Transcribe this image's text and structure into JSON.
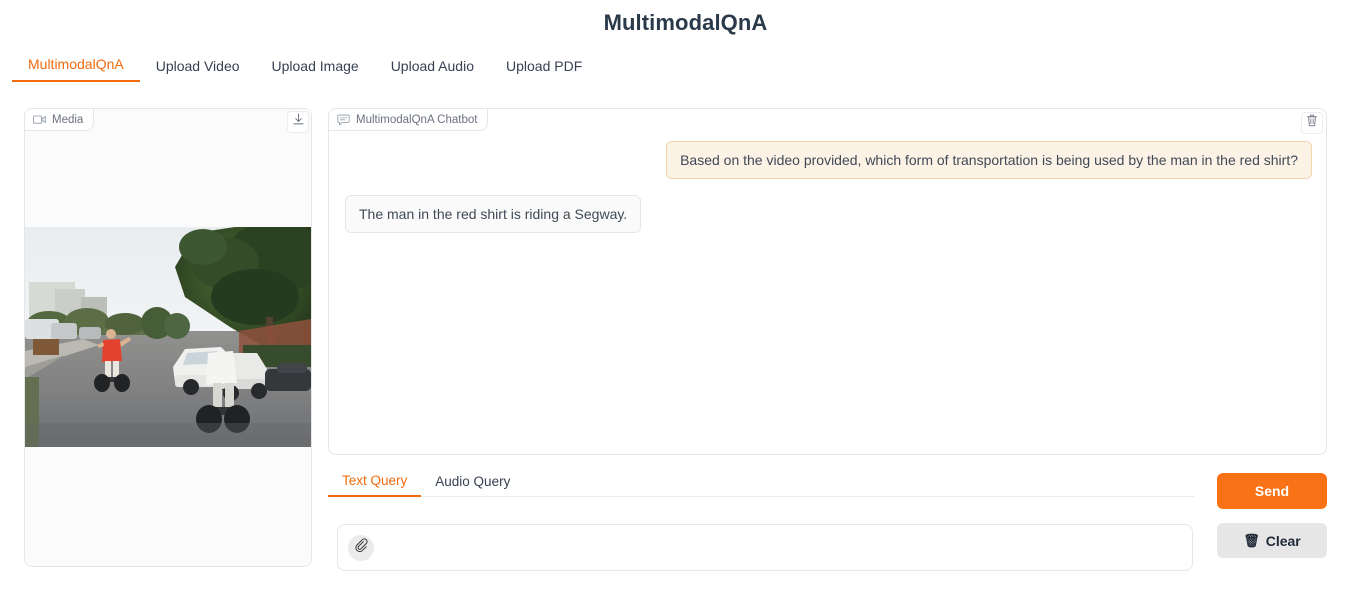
{
  "header": {
    "title": "MultimodalQnA"
  },
  "top_tabs": [
    {
      "label": "MultimodalQnA",
      "active": true
    },
    {
      "label": "Upload Video",
      "active": false
    },
    {
      "label": "Upload Image",
      "active": false
    },
    {
      "label": "Upload Audio",
      "active": false
    },
    {
      "label": "Upload PDF",
      "active": false
    }
  ],
  "media_panel": {
    "chip_label": "Media",
    "chip_icon": "video-camera-icon",
    "download_icon": "download-icon",
    "media_type": "video",
    "frame_description": "Two people riding Segways down a residential street lined with trees and parked cars; the nearer man wears a red shirt."
  },
  "chat_panel": {
    "chip_label": "MultimodalQnA Chatbot",
    "chip_icon": "chat-bubble-icon",
    "clear_icon": "trash-icon",
    "messages": [
      {
        "role": "user",
        "text": "Based on the video provided, which form of transportation is being used by the man in the red shirt?"
      },
      {
        "role": "bot",
        "text": "The man in the red shirt is riding a Segway."
      }
    ]
  },
  "query_tabs": [
    {
      "label": "Text Query",
      "active": true
    },
    {
      "label": "Audio Query",
      "active": false
    }
  ],
  "text_input": {
    "value": "",
    "placeholder": "",
    "attach_icon": "paperclip-icon"
  },
  "actions": {
    "send_label": "Send",
    "clear_label": "Clear",
    "clear_icon": "wastebasket-icon"
  },
  "colors": {
    "accent": "#f26b0f",
    "send_button": "#f97316",
    "user_bubble_bg": "#fdf2e6",
    "user_bubble_border": "#f3d5ac",
    "bot_bubble_bg": "#fafafa",
    "title": "#2b3a4a"
  }
}
